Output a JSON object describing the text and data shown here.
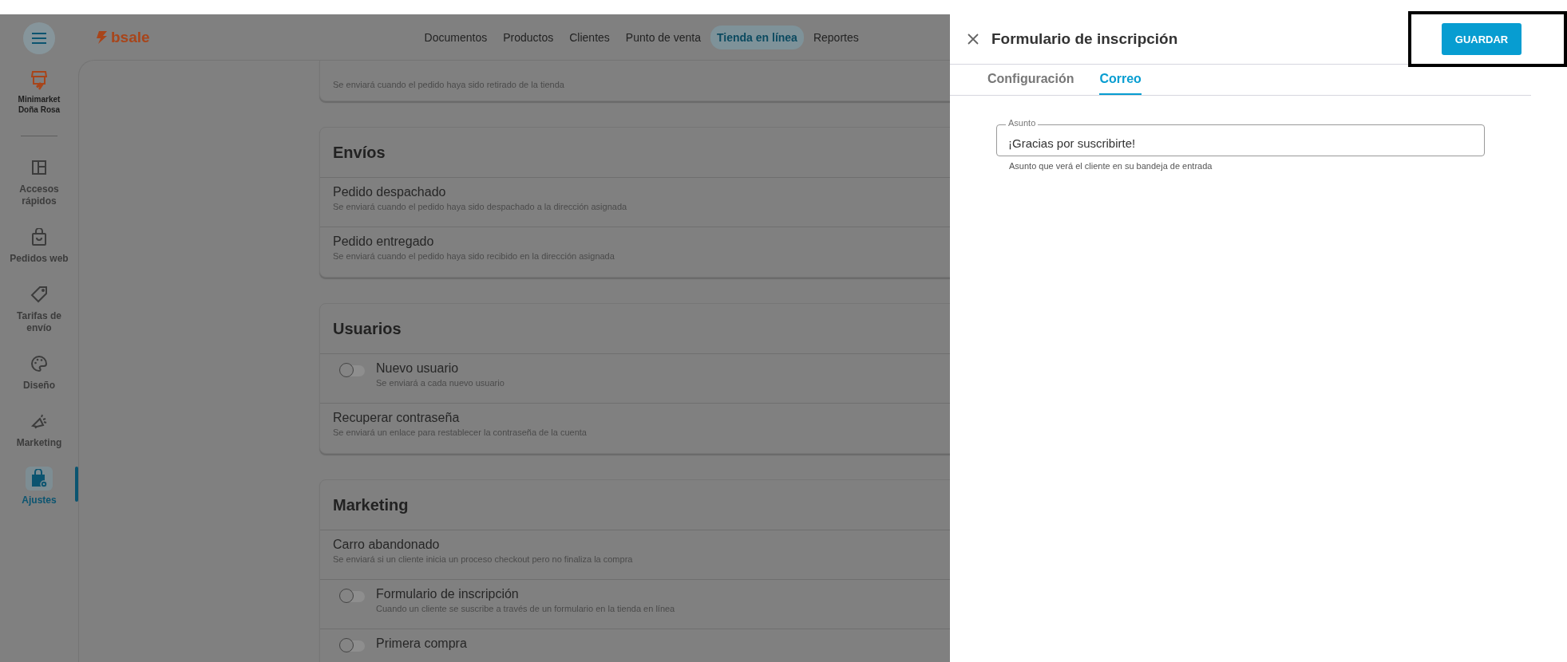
{
  "brand": {
    "name": "bsale"
  },
  "nav": [
    {
      "label": "Documentos",
      "selected": false
    },
    {
      "label": "Productos",
      "selected": false
    },
    {
      "label": "Clientes",
      "selected": false
    },
    {
      "label": "Punto de venta",
      "selected": false
    },
    {
      "label": "Tienda en línea",
      "selected": true
    },
    {
      "label": "Reportes",
      "selected": false
    }
  ],
  "store": {
    "name": "Minimarket Doña Rosa"
  },
  "sidebar": {
    "items": [
      {
        "label": "Accesos rápidos",
        "selected": false
      },
      {
        "label": "Pedidos web",
        "selected": false
      },
      {
        "label": "Tarifas de envío",
        "selected": false
      },
      {
        "label": "Diseño",
        "selected": false
      },
      {
        "label": "Marketing",
        "selected": false
      },
      {
        "label": "Ajustes",
        "selected": true
      }
    ]
  },
  "sections": [
    {
      "items": [
        {
          "kind": "plain",
          "description": "Se enviará cuando el pedido haya sido retirado de la tienda"
        }
      ]
    },
    {
      "title": "Envíos",
      "items": [
        {
          "kind": "plain",
          "title": "Pedido despachado",
          "description": "Se enviará cuando el pedido haya sido despachado a la dirección asignada"
        },
        {
          "kind": "plain",
          "title": "Pedido entregado",
          "description": "Se enviará cuando el pedido haya sido recibido en la dirección asignada"
        }
      ]
    },
    {
      "title": "Usuarios",
      "items": [
        {
          "kind": "toggle",
          "on": false,
          "title": "Nuevo usuario",
          "description": "Se enviará a cada nuevo usuario"
        },
        {
          "kind": "plain",
          "title": "Recuperar contraseña",
          "description": "Se enviará un enlace para restablecer la contraseña de la cuenta"
        }
      ]
    },
    {
      "title": "Marketing",
      "items": [
        {
          "kind": "plain",
          "title": "Carro abandonado",
          "description": "Se enviará si un cliente inicia un proceso checkout pero no finaliza la compra"
        },
        {
          "kind": "toggle",
          "on": false,
          "title": "Formulario de inscripción",
          "description": "Cuando un cliente se suscribe a través de un formulario en la tienda en línea"
        },
        {
          "kind": "toggle",
          "on": false,
          "title": "Primera compra"
        }
      ]
    }
  ],
  "panel": {
    "title": "Formulario de inscripción",
    "save_button": "GUARDAR",
    "tabs": [
      {
        "label": "Configuración",
        "selected": false
      },
      {
        "label": "Correo",
        "selected": true
      }
    ],
    "subject": {
      "label": "Asunto",
      "value": "¡Gracias por suscribirte!",
      "hint": "Asunto que verá el cliente en su bandeja de entrada"
    }
  }
}
